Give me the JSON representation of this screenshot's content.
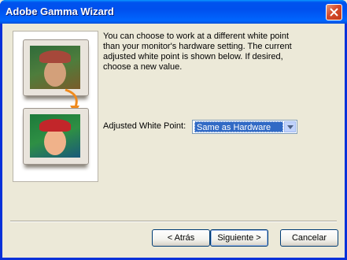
{
  "window": {
    "title": "Adobe Gamma Wizard"
  },
  "description": {
    "lines": [
      "You can choose to work at a different white point",
      "than your monitor's hardware setting. The current",
      "adjusted white point is shown below. If desired,",
      "choose a new value."
    ]
  },
  "white_point": {
    "label": "Adjusted White Point:",
    "value": "Same as Hardware"
  },
  "buttons": {
    "back": "< Atrás",
    "next": "Siguiente >",
    "cancel": "Cancelar"
  },
  "icons": [
    "close-icon",
    "dropdown-arrow-icon",
    "curved-arrow-icon"
  ],
  "colors": {
    "titlebar": "#0054e3",
    "selection": "#316ac5",
    "dialog_bg": "#ece9d8"
  }
}
